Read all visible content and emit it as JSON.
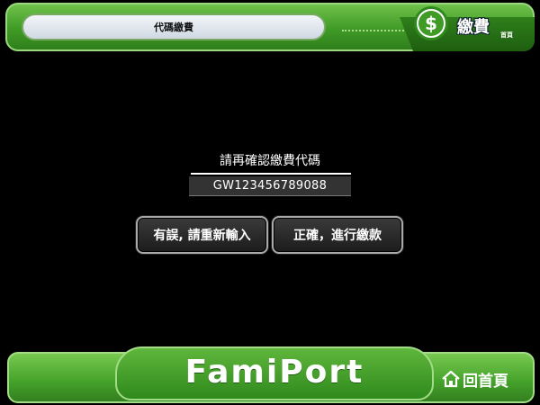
{
  "header": {
    "title": "代碼繳費",
    "section_label": "繳費",
    "home_small": "首頁",
    "section_icon": "dollar-icon",
    "section_icon_glyph": "$"
  },
  "main": {
    "prompt": "請再確認繳費代碼",
    "code_value": "GW123456789088",
    "buttons": {
      "retry": "有誤, 請重新輸入",
      "confirm": "正確，進行繳款"
    }
  },
  "footer": {
    "logo": "FamiPort",
    "home_label": "回首頁",
    "home_icon": "house-icon"
  },
  "colors": {
    "brand_green": "#43a12a",
    "background": "#000000"
  }
}
